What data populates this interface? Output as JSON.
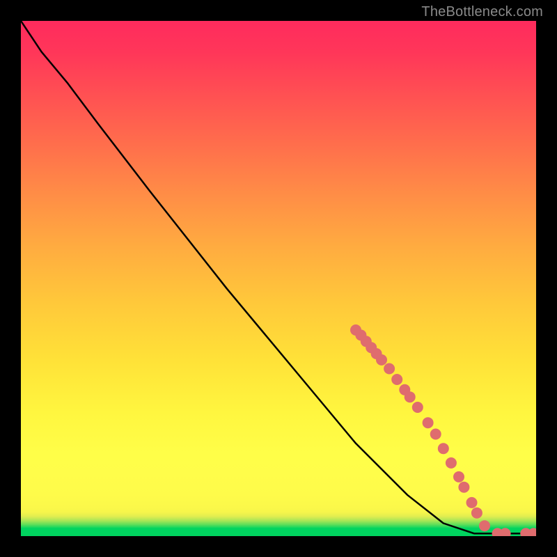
{
  "attribution": "TheBottleneck.com",
  "chart_data": {
    "type": "line",
    "title": "",
    "xlabel": "",
    "ylabel": "",
    "xlim": [
      0,
      100
    ],
    "ylim": [
      0,
      100
    ],
    "grid": false,
    "legend": false,
    "background_gradient": {
      "stops": [
        {
          "pos": 0.0,
          "color": "#00d45f"
        },
        {
          "pos": 0.05,
          "color": "#fbf84a"
        },
        {
          "pos": 0.12,
          "color": "#fffd4a"
        },
        {
          "pos": 0.45,
          "color": "#ffc93a"
        },
        {
          "pos": 0.76,
          "color": "#ff6e4c"
        },
        {
          "pos": 1.0,
          "color": "#ff2b5d"
        }
      ]
    },
    "series": [
      {
        "name": "curve",
        "points": [
          {
            "x": 0.0,
            "y": 100.0
          },
          {
            "x": 4.0,
            "y": 94.0
          },
          {
            "x": 9.0,
            "y": 88.0
          },
          {
            "x": 15.0,
            "y": 80.0
          },
          {
            "x": 25.0,
            "y": 67.0
          },
          {
            "x": 40.0,
            "y": 48.0
          },
          {
            "x": 55.0,
            "y": 30.0
          },
          {
            "x": 65.0,
            "y": 18.0
          },
          {
            "x": 75.0,
            "y": 8.0
          },
          {
            "x": 82.0,
            "y": 2.5
          },
          {
            "x": 88.0,
            "y": 0.5
          },
          {
            "x": 100.0,
            "y": 0.5
          }
        ]
      }
    ],
    "markers": [
      {
        "x": 65.0,
        "y": 40.0
      },
      {
        "x": 66.0,
        "y": 39.0
      },
      {
        "x": 67.0,
        "y": 37.8
      },
      {
        "x": 68.0,
        "y": 36.6
      },
      {
        "x": 69.0,
        "y": 35.4
      },
      {
        "x": 70.0,
        "y": 34.2
      },
      {
        "x": 71.5,
        "y": 32.5
      },
      {
        "x": 73.0,
        "y": 30.4
      },
      {
        "x": 74.5,
        "y": 28.4
      },
      {
        "x": 75.5,
        "y": 27.0
      },
      {
        "x": 77.0,
        "y": 25.0
      },
      {
        "x": 79.0,
        "y": 22.0
      },
      {
        "x": 80.5,
        "y": 19.8
      },
      {
        "x": 82.0,
        "y": 17.0
      },
      {
        "x": 83.5,
        "y": 14.2
      },
      {
        "x": 85.0,
        "y": 11.5
      },
      {
        "x": 86.0,
        "y": 9.5
      },
      {
        "x": 87.5,
        "y": 6.5
      },
      {
        "x": 88.5,
        "y": 4.5
      },
      {
        "x": 90.0,
        "y": 2.0
      },
      {
        "x": 92.5,
        "y": 0.5
      },
      {
        "x": 94.0,
        "y": 0.5
      },
      {
        "x": 98.0,
        "y": 0.5
      },
      {
        "x": 99.5,
        "y": 0.5
      }
    ],
    "marker_color": "#df6c6e",
    "line_color": "#000000"
  }
}
